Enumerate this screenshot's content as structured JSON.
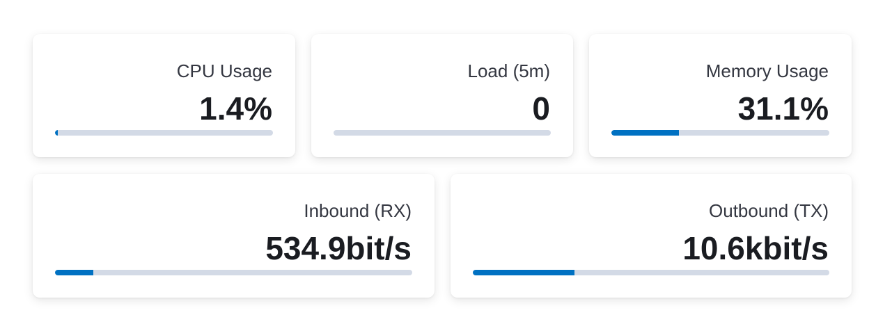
{
  "metrics": [
    {
      "id": "cpu",
      "label": "CPU Usage",
      "value": "1.4%",
      "progress": 0.014
    },
    {
      "id": "load",
      "label": "Load (5m)",
      "value": "0",
      "progress": 0
    },
    {
      "id": "mem",
      "label": "Memory Usage",
      "value": "31.1%",
      "progress": 0.311
    },
    {
      "id": "rx",
      "label": "Inbound (RX)",
      "value": "534.9bit/s",
      "progress": 0.107
    },
    {
      "id": "tx",
      "label": "Outbound (TX)",
      "value": "10.6kbit/s",
      "progress": 0.286
    }
  ],
  "colors": {
    "bar_fill": "#0071c2",
    "bar_track": "#d3dae6",
    "label": "#343741",
    "value": "#1a1c21"
  }
}
